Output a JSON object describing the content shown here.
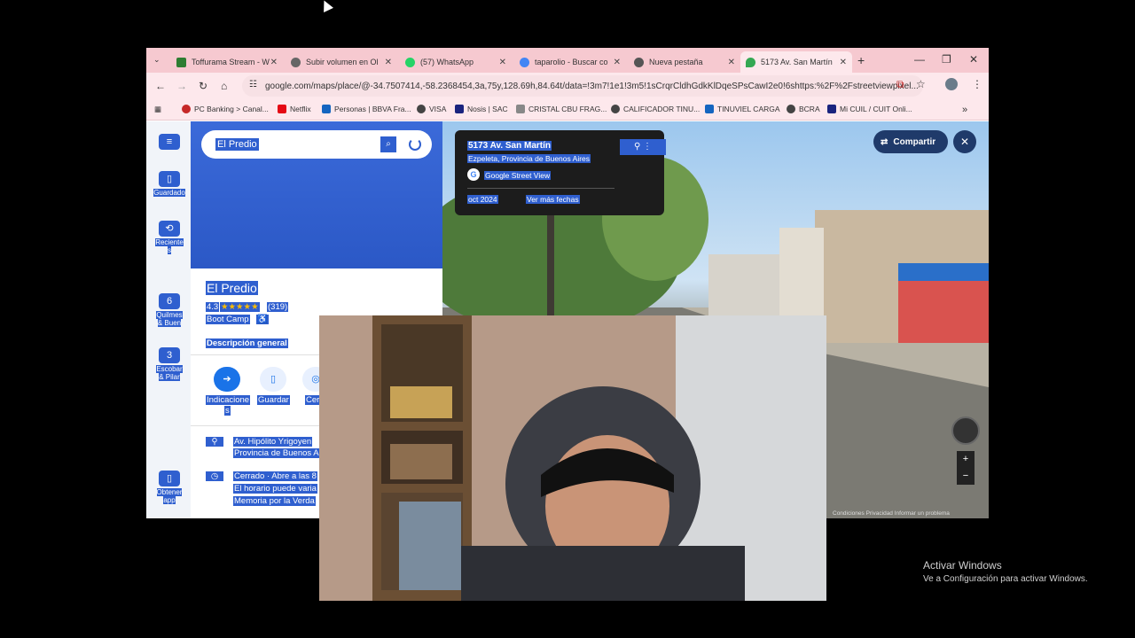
{
  "browser": {
    "tabs": [
      {
        "title": "Toffurama Stream - W",
        "color": "#2e7d32",
        "active": false
      },
      {
        "title": "Subir volumen en Ol",
        "color": "#666666",
        "active": false
      },
      {
        "title": "(57) WhatsApp",
        "color": "#25d366",
        "active": false
      },
      {
        "title": "taparolio - Buscar co",
        "color": "#4285f4",
        "active": false
      },
      {
        "title": "Nueva pestaña",
        "color": "#555555",
        "active": false
      },
      {
        "title": "5173 Av. San Martín",
        "color": "#34a853",
        "active": true
      }
    ],
    "url": "google.com/maps/place/@-34.7507414,-58.2368454,3a,75y,128.69h,84.64t/data=!3m7!1e1!3m5!1sCrqrCldhGdkKlDqeSPsCawI2e0!6shttps:%2F%2Fstreetviewpixel...",
    "bookmarks": [
      {
        "label": "PC Banking > Canal...",
        "color": "#c62828"
      },
      {
        "label": "Netflix",
        "color": "#e50914"
      },
      {
        "label": "Personas | BBVA Fra...",
        "color": "#1565c0"
      },
      {
        "label": "VISA",
        "color": "#444444"
      },
      {
        "label": "Nosis | SAC",
        "color": "#1a237e"
      },
      {
        "label": "CRISTAL CBU FRAG...",
        "color": "#888888"
      },
      {
        "label": "CALIFICADOR TINU...",
        "color": "#444444"
      },
      {
        "label": "TINUVIEL CARGA",
        "color": "#1565c0"
      },
      {
        "label": "BCRA",
        "color": "#444444"
      },
      {
        "label": "Mi CUIL / CUIT Onli...",
        "color": "#1a237e"
      }
    ]
  },
  "maps": {
    "rail": {
      "guardado": "Guardado",
      "recientes_1": "Reciente",
      "recientes_2": "s",
      "quilmes_count": "6",
      "quilmes_1": "Quilmes",
      "quilmes_2": "& Buen",
      "escobar_count": "3",
      "escobar_1": "Escobar",
      "escobar_2": "& Pilar",
      "app_1": "Obtener",
      "app_2": "app"
    },
    "search_query": "El Predio",
    "place": {
      "title": "El Predio",
      "rating": "4.3",
      "stars": "★★★★★",
      "reviews": "(319)",
      "category": "Boot Camp",
      "accessible": "♿",
      "tab_overview": "Descripción general",
      "actions": [
        "Indicacione",
        "s",
        "Guardar",
        "Cer"
      ],
      "address_1": "Av. Hipólito Yrigoyen",
      "address_2": "Provincia de Buenos A",
      "hours_1": "Cerrado · Abre a las 8",
      "hours_2": "El horario puede varia",
      "hours_3": "Memoria por la Verda"
    },
    "streetview": {
      "address": "5173 Av. San Martín",
      "locality": "Ezpeleta, Provincia de Buenos Aires",
      "source": "Google Street View",
      "date": "oct 2024",
      "more_dates": "Ver más fechas",
      "share": "Compartir",
      "footer": "Condiciones    Privacidad    Informar un problema"
    }
  },
  "windows": {
    "activate_title": "Activar Windows",
    "activate_sub": "Ve a Configuración para activar Windows."
  }
}
